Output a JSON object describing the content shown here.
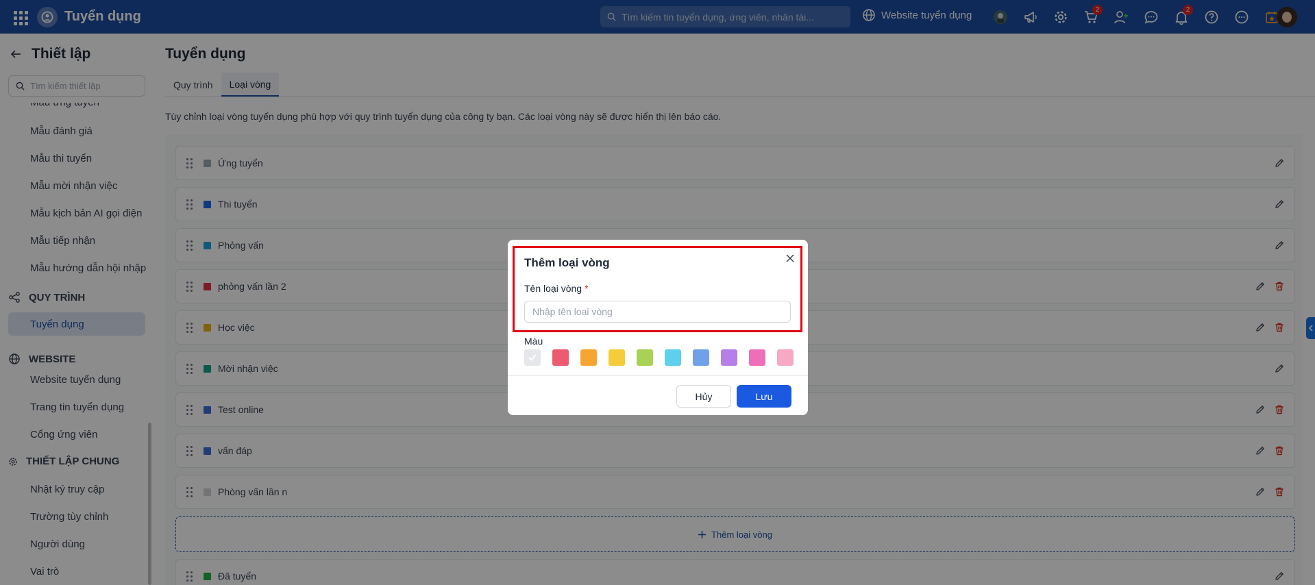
{
  "topbar": {
    "app_title": "Tuyển dụng",
    "search_placeholder": "Tìm kiếm tin tuyển dụng, ứng viên, nhân tài...",
    "website_label": "Website tuyển dụng",
    "cart_badge": "2",
    "notification_badge": "2"
  },
  "sidebar": {
    "title": "Thiết lập",
    "search_placeholder": "Tìm kiếm thiết lập",
    "items_top": [
      "Mẫu ứng tuyển",
      "Mẫu đánh giá",
      "Mẫu thi tuyển",
      "Mẫu mời nhận việc",
      "Mẫu kịch bản AI gọi điện",
      "Mẫu tiếp nhận",
      "Mẫu hướng dẫn hội nhập"
    ],
    "section_process": "QUY TRÌNH",
    "active_item": "Tuyển dụng",
    "section_website": "WEBSITE",
    "website_items": [
      "Website tuyển dụng",
      "Trang tin tuyển dụng",
      "Cổng ứng viên"
    ],
    "section_general": "THIẾT LẬP CHUNG",
    "general_items": [
      "Nhật ký truy cập",
      "Trường tùy chỉnh",
      "Người dùng",
      "Vai trò"
    ]
  },
  "main": {
    "title": "Tuyển dụng",
    "tabs": [
      "Quy trình",
      "Loại vòng"
    ],
    "description": "Tùy chỉnh loại vòng tuyển dụng phù hợp với quy trình tuyển dụng của công ty bạn. Các loại vòng này sẽ được hiển thị lên báo cáo.",
    "rounds": [
      {
        "label": "Ứng tuyển",
        "color": "#9ca9b3",
        "deletable": false
      },
      {
        "label": "Thi tuyển",
        "color": "#1c6ae8",
        "deletable": false
      },
      {
        "label": "Phỏng vấn",
        "color": "#1fa3e0",
        "deletable": false
      },
      {
        "label": "phỏng vấn lần 2",
        "color": "#e03347",
        "deletable": true
      },
      {
        "label": "Học việc",
        "color": "#e7b416",
        "deletable": true
      },
      {
        "label": "Mời nhận việc",
        "color": "#13a58b",
        "deletable": false
      },
      {
        "label": "Test online",
        "color": "#3b6fd6",
        "deletable": true
      },
      {
        "label": "vấn đáp",
        "color": "#3b6fd6",
        "deletable": true
      },
      {
        "label": "Phòng vấn lần n",
        "color": "#d4d4d4",
        "deletable": true
      }
    ],
    "add_round_label": "Thêm loại vòng",
    "last_round": {
      "label": "Đã tuyển",
      "color": "#22b14c"
    }
  },
  "modal": {
    "title": "Thêm loại vòng",
    "name_label": "Tên loại vòng",
    "required_mark": "*",
    "name_placeholder": "Nhập tên loại vòng",
    "name_value": "",
    "color_label": "Màu",
    "colors": [
      "#e5e7eb",
      "#ee5a6f",
      "#f7a531",
      "#f5cc3a",
      "#a9d155",
      "#5cd0ec",
      "#6fa0e8",
      "#b57ee8",
      "#ee6fb7",
      "#f7a8c3"
    ],
    "selected_color_index": 0,
    "cancel_label": "Hủy",
    "save_label": "Lưu"
  }
}
